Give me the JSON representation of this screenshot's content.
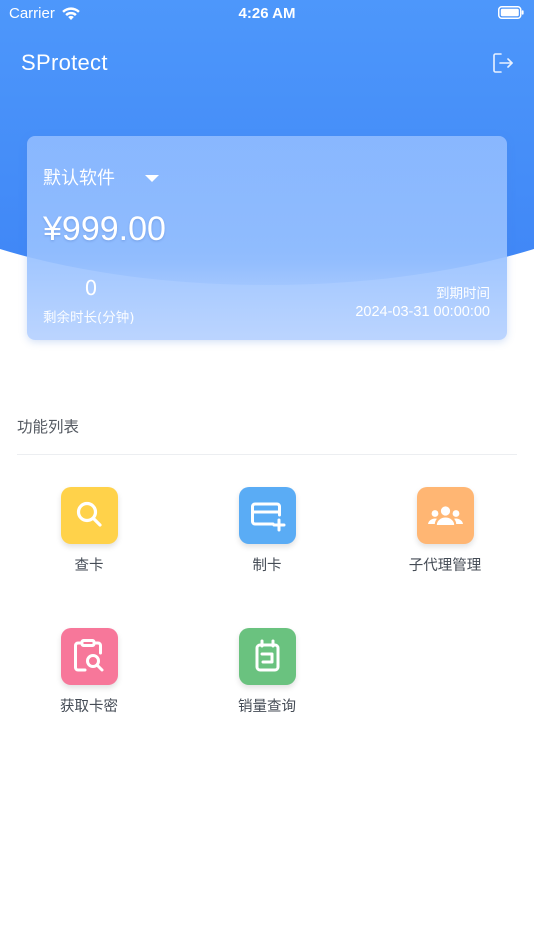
{
  "status_bar": {
    "carrier": "Carrier",
    "time": "4:26 AM"
  },
  "nav": {
    "title": "SProtect",
    "logout_icon": "logout-icon"
  },
  "card": {
    "software_name": "默认软件",
    "price": "¥999.00",
    "remain_value": "0",
    "remain_label": "剩余时长(分钟)",
    "expire_label": "到期时间",
    "expire_value": "2024-03-31 00:00:00"
  },
  "section": {
    "title": "功能列表"
  },
  "functions": [
    {
      "label": "查卡",
      "icon": "search-icon",
      "color": "#ffd24a"
    },
    {
      "label": "制卡",
      "icon": "card-add-icon",
      "color": "#5aacf5"
    },
    {
      "label": "子代理管理",
      "icon": "users-icon",
      "color": "#ffb673"
    },
    {
      "label": "获取卡密",
      "icon": "clipboard-search-icon",
      "color": "#f7779a"
    },
    {
      "label": "销量查询",
      "icon": "sales-icon",
      "color": "#6ac27f"
    }
  ],
  "colors": {
    "header_blue": "#4e98fb",
    "accent_yellow": "#ffd24a",
    "accent_blue": "#5aacf5",
    "accent_orange": "#ffb673",
    "accent_pink": "#f7779a",
    "accent_green": "#6ac27f"
  }
}
